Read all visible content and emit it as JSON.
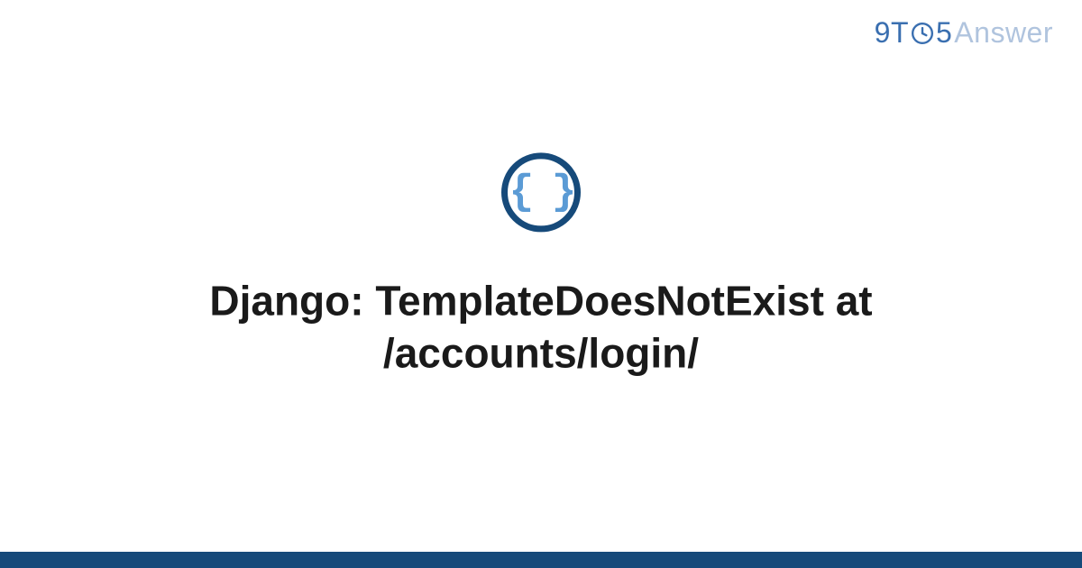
{
  "brand": {
    "part1": "9T",
    "part2": "5",
    "part3": "Answer"
  },
  "icon": {
    "braces": "{ }"
  },
  "title": "Django: TemplateDoesNotExist at /accounts/login/",
  "colors": {
    "brand_primary": "#3a6fb0",
    "brand_light": "#b0c4de",
    "icon_ring": "#164a7a",
    "icon_braces": "#5b9bd5",
    "footer": "#164a7a"
  }
}
